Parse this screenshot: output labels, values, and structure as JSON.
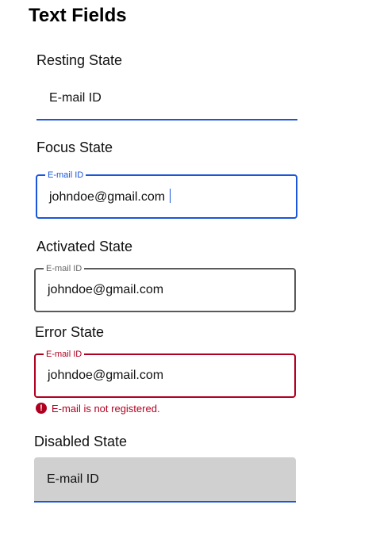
{
  "page_title": "Text Fields",
  "sections": {
    "resting": {
      "label": "Resting State",
      "placeholder": "E-mail ID"
    },
    "focus": {
      "label": "Focus State",
      "field_label": "E-mail ID",
      "value": "johndoe@gmail.com"
    },
    "activated": {
      "label": "Activated State",
      "field_label": "E-mail ID",
      "value": "johndoe@gmail.com"
    },
    "error": {
      "label": "Error State",
      "field_label": "E-mail ID",
      "value": "johndoe@gmail.com",
      "error_message": "E-mail is not registered.",
      "error_icon": "!"
    },
    "disabled": {
      "label": "Disabled State",
      "placeholder": "E-mail ID"
    }
  },
  "colors": {
    "focus": "#1a56db",
    "error": "#b00020",
    "activated_border": "#5a5a5a",
    "disabled_fill": "#d0d0d0"
  },
  "icons": {
    "error": "error-circle-icon"
  }
}
